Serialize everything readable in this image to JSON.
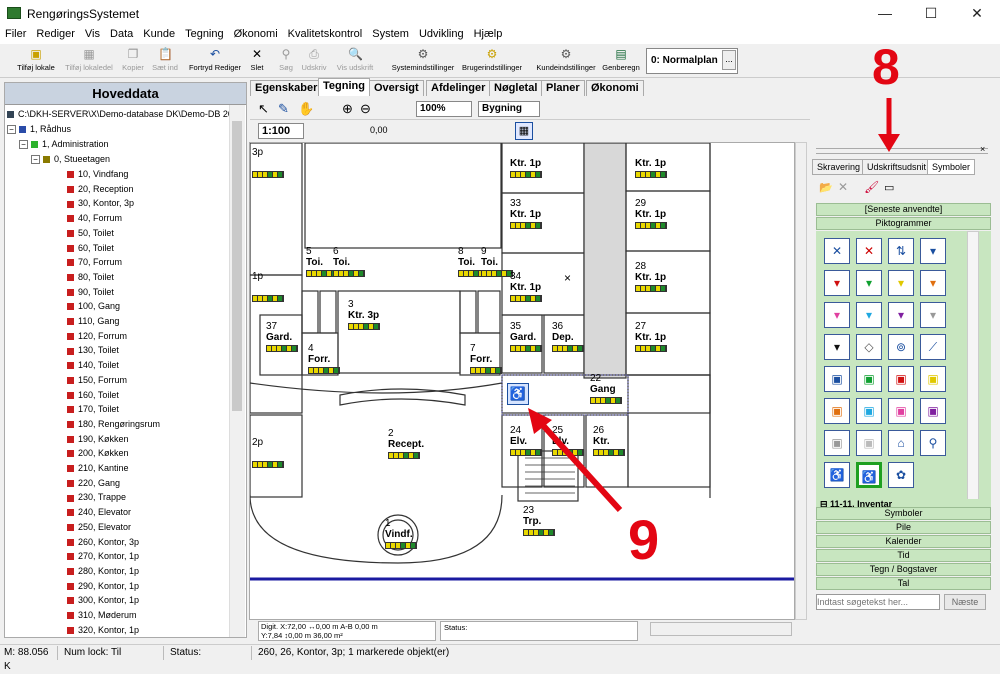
{
  "window": {
    "title": "RengøringsSystemet",
    "minimize": "—",
    "maximize": "☐",
    "close": "✕"
  },
  "menu": [
    "Filer",
    "Rediger",
    "Vis",
    "Data",
    "Kunde",
    "Tegning",
    "Økonomi",
    "Kvalitetskontrol",
    "System",
    "Udvikling",
    "Hjælp"
  ],
  "toolbar": {
    "tilfoj_lokale": "Tilføj lokale",
    "tilfoj_lokaledel": "Tilføj lokaledel",
    "kopier": "Kopier",
    "saet_ind": "Sæt ind",
    "fortryd_rediger": "Fortryd Rediger",
    "slet": "Slet",
    "sog": "Søg",
    "udskriv": "Udskriv",
    "vis_udskrift": "Vis udskrift",
    "systemindstillinger": "Systemindstillinger",
    "brugerindstillinger": "Brugerindstillinger",
    "kundeindstillinger": "Kundeindstillinger",
    "genberegn": "Genberegn",
    "plan": "0: Normalplan",
    "plan_btn": "..."
  },
  "left": {
    "header": "Hoveddata",
    "root": "C:\\DKH-SERVER\\X\\Demo-database DK\\Demo-DB 2006",
    "level1": "1, Rådhus",
    "level2": "1, Administration",
    "level3": "0, Stueetagen",
    "rooms": [
      "10, Vindfang",
      "20, Reception",
      "30, Kontor, 3p",
      "40, Forrum",
      "50, Toilet",
      "60, Toilet",
      "70, Forrum",
      "80, Toilet",
      "90, Toilet",
      "100, Gang",
      "110, Gang",
      "120, Forrum",
      "130, Toilet",
      "140, Toilet",
      "150, Forrum",
      "160, Toilet",
      "170, Toilet",
      "180, Rengøringsrum",
      "190, Køkken",
      "200, Køkken",
      "210, Kantine",
      "220, Gang",
      "230, Trappe",
      "240, Elevator",
      "250, Elevator",
      "260, Kontor, 3p",
      "270, Kontor, 1p",
      "280, Kontor, 1p",
      "290, Kontor, 1p",
      "300, Kontor, 1p",
      "310, Møderum",
      "320, Kontor, 1p"
    ]
  },
  "tabs": [
    "Egenskaber",
    "Tegning",
    "Oversigt",
    "Afdelinger",
    "Nøgletal",
    "Planer",
    "Økonomi"
  ],
  "drawing_toolbar": {
    "zoom": "100%",
    "layer": "Bygning",
    "scale": "1:100",
    "line": "0,00"
  },
  "rooms": [
    {
      "num": "3p",
      "name": ""
    },
    {
      "num": "5",
      "name": "Toi."
    },
    {
      "num": "6",
      "name": "Toi."
    },
    {
      "num": "8",
      "name": "Toi."
    },
    {
      "num": "9",
      "name": "Toi."
    },
    {
      "num": "1p",
      "name": ""
    },
    {
      "num": "3",
      "name": "Ktr. 3p"
    },
    {
      "num": "37",
      "name": "Gard."
    },
    {
      "num": "4",
      "name": "Forr."
    },
    {
      "num": "7",
      "name": "Forr."
    },
    {
      "num": "2p",
      "name": ""
    },
    {
      "num": "2",
      "name": "Recept."
    },
    {
      "num": "1",
      "name": "Vindf."
    },
    {
      "num": "23",
      "name": "Trp."
    },
    {
      "num": "33",
      "name": "Ktr. 1p"
    },
    {
      "num": "34",
      "name": "Ktr. 1p"
    },
    {
      "num": "35",
      "name": "Gard."
    },
    {
      "num": "36",
      "name": "Dep."
    },
    {
      "num": "22",
      "name": "Gang"
    },
    {
      "num": "24",
      "name": "Elv."
    },
    {
      "num": "25",
      "name": "Elv."
    },
    {
      "num": "26",
      "name": "Ktr."
    },
    {
      "num": "29",
      "name": "Ktr. 1p"
    },
    {
      "num": "28",
      "name": "Ktr. 1p"
    },
    {
      "num": "27",
      "name": "Ktr. 1p"
    },
    {
      "num": "",
      "name": "Ktr. 1p"
    },
    {
      "num": "",
      "name": "Ktr. 1p"
    }
  ],
  "coords": {
    "dig_x": "Digit. X:72,00",
    "dig_y": "Y:7,84",
    "dx": "↔0,00 m",
    "dy": "↕0,00 m",
    "ab": "A-B 0,00 m",
    "area": "36,00 m²",
    "status": "Status:"
  },
  "right": {
    "tabs": [
      "Skravering",
      "Udskriftsudsnit",
      "Symboler"
    ],
    "recent": "[Seneste anvendte]",
    "pictograms": "Piktogrammer",
    "inventory": "11-11. Inventar",
    "groups": [
      "Symboler",
      "Pile",
      "Kalender",
      "Tid",
      "Tegn / Bogstaver",
      "Tal"
    ],
    "search_placeholder": "Indtast søgetekst her...",
    "next": "Næste"
  },
  "statusbar": {
    "mem": "M: 88.056 K",
    "numlock": "Num lock: Til",
    "status": "Status:",
    "selection": "260, 26, Kontor, 3p; 1 markerede objekt(er)"
  },
  "annotations": {
    "eight": "8",
    "nine": "9"
  },
  "colors": {
    "accent_red": "#e30613",
    "header_blue": "#c9d3e0",
    "symbol_green": "#c8e6c0"
  }
}
